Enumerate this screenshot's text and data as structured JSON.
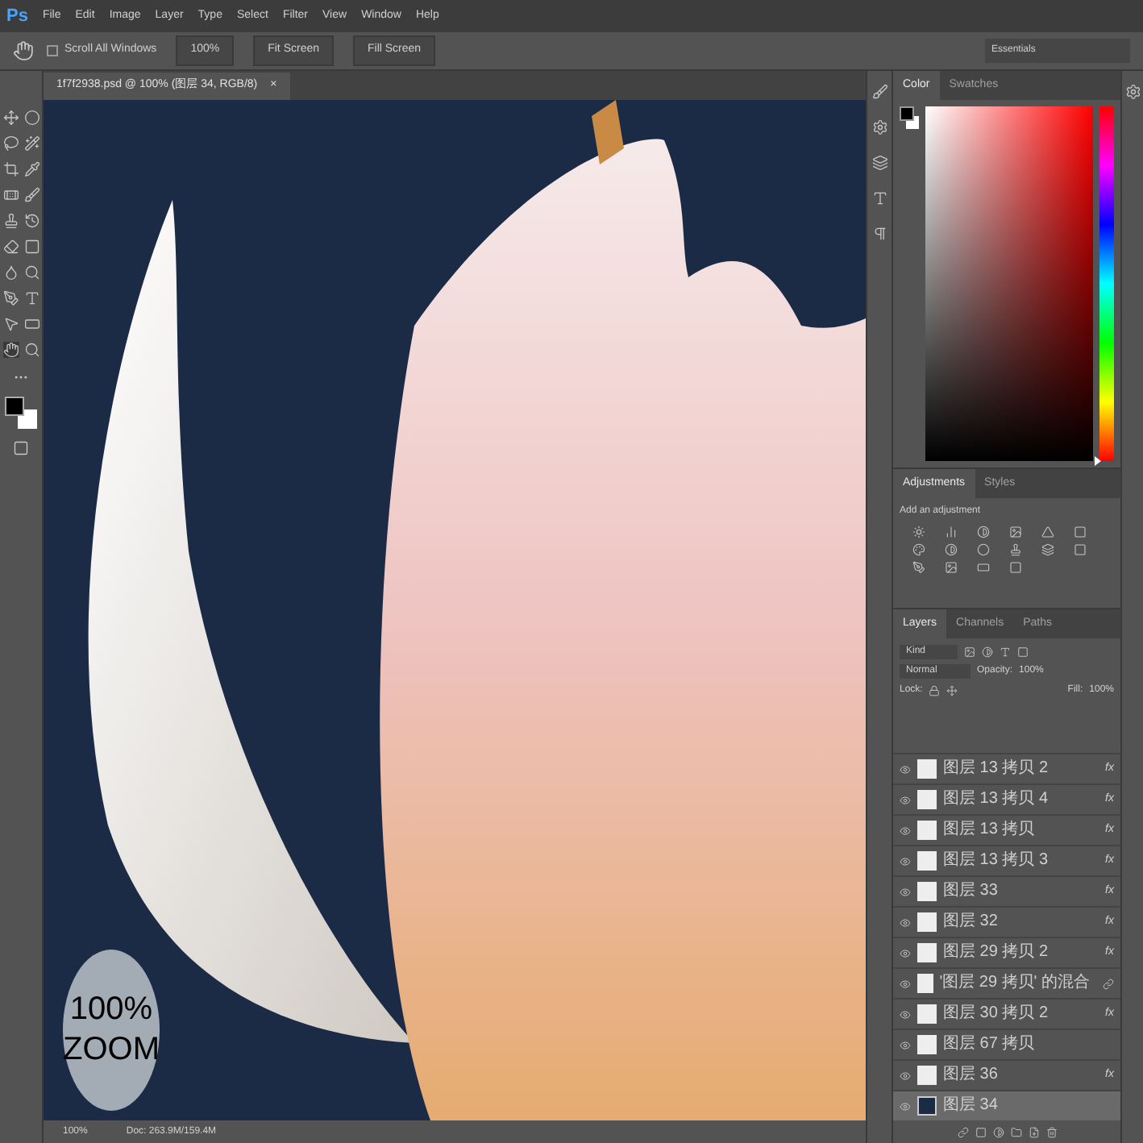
{
  "menu_bar": {
    "logo": "Ps",
    "items": [
      "File",
      "Edit",
      "Image",
      "Layer",
      "Type",
      "Select",
      "Filter",
      "View",
      "Window",
      "Help"
    ]
  },
  "options_bar": {
    "scroll_all_windows": {
      "label": "Scroll All Windows",
      "checked": false
    },
    "buttons": [
      "100%",
      "Fit Screen",
      "Fill Screen"
    ],
    "workspace": "Essentials"
  },
  "document_tab": {
    "title": "1f7f2938.psd @ 100% (图层 34, RGB/8)",
    "close": "×"
  },
  "canvas": {
    "zoom_badge": [
      "100%",
      "ZOOM"
    ]
  },
  "status_bar": {
    "zoom": "100%",
    "doc": "Doc: 263.9M/159.4M"
  },
  "color_panel": {
    "tabs": [
      {
        "label": "Color",
        "selected": true
      },
      {
        "label": "Swatches",
        "selected": false
      }
    ],
    "hue": {
      "level": 0
    }
  },
  "adjustments_panel": {
    "tabs": [
      {
        "label": "Adjustments",
        "selected": true
      },
      {
        "label": "Styles",
        "selected": false
      }
    ],
    "hint": "Add an adjustment"
  },
  "layers_panel": {
    "tabs": [
      {
        "label": "Layers",
        "selected": true
      },
      {
        "label": "Channels",
        "selected": false
      },
      {
        "label": "Paths",
        "selected": false
      }
    ],
    "filter": "Kind",
    "blend_mode": "Normal",
    "opacity_label": "Opacity:",
    "opacity": "100%",
    "lock_label": "Lock:",
    "fill_label": "Fill:",
    "fill": "100%",
    "layers": [
      {
        "name": "图层 13 拷贝 2",
        "visible": true,
        "selected": false,
        "kind": "fx",
        "badge": "fx"
      },
      {
        "name": "图层 13 拷贝 4",
        "visible": true,
        "selected": false,
        "kind": "fx",
        "badge": "fx"
      },
      {
        "name": "图层 13 拷贝",
        "visible": true,
        "selected": false,
        "kind": "fx",
        "badge": "fx"
      },
      {
        "name": "图层 13 拷贝 3",
        "visible": true,
        "selected": false,
        "kind": "fx",
        "badge": "fx"
      },
      {
        "name": "图层 33",
        "visible": true,
        "selected": false,
        "kind": "fx",
        "badge": "fx"
      },
      {
        "name": "图层 32",
        "visible": true,
        "selected": false,
        "kind": "fx",
        "badge": "fx"
      },
      {
        "name": "图层 29 拷贝 2",
        "visible": true,
        "selected": false,
        "kind": "fx",
        "badge": "fx"
      },
      {
        "name": "'图层 29 拷贝' 的混合",
        "visible": true,
        "selected": false,
        "kind": "smart"
      },
      {
        "name": "图层 30 拷贝 2",
        "visible": true,
        "selected": false,
        "kind": "fx",
        "badge": "fx"
      },
      {
        "name": "图层 67 拷贝",
        "visible": true,
        "selected": false,
        "kind": "plain"
      },
      {
        "name": "图层 36",
        "visible": true,
        "selected": false,
        "kind": "fx",
        "badge": "fx"
      },
      {
        "name": "图层 34",
        "visible": true,
        "selected": true,
        "kind": "fill"
      }
    ]
  }
}
